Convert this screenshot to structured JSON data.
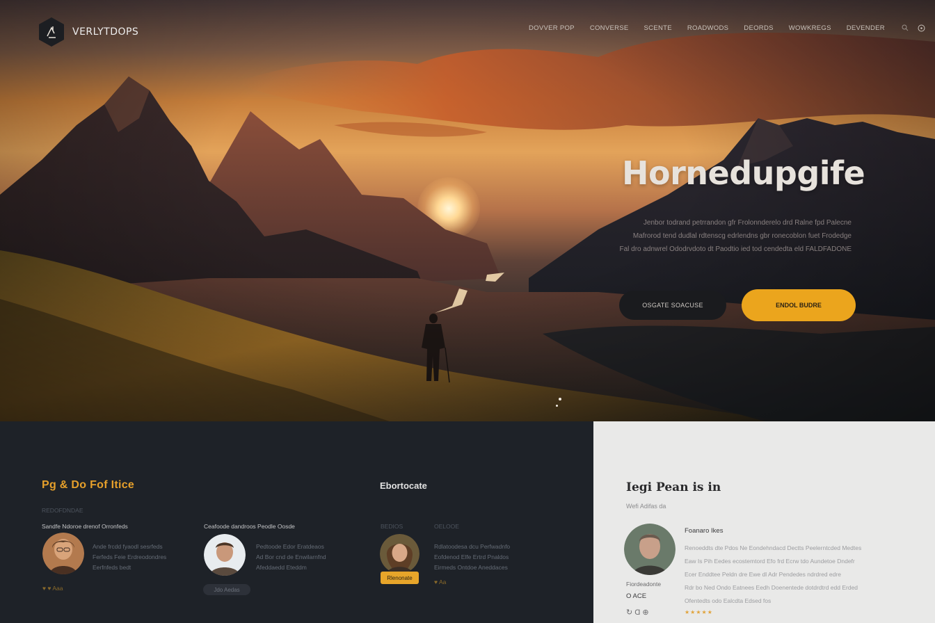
{
  "brand": {
    "name": "VERLYTDOPS"
  },
  "nav": {
    "items": [
      "DOVVER POP",
      "CONVERSE",
      "SCENTE",
      "ROADWODS",
      "DEORDS",
      "WOWKREGS",
      "DEVENDER"
    ],
    "icons": [
      "search-icon",
      "globe-icon"
    ]
  },
  "hero": {
    "title": "Hornedupgife",
    "description": [
      "Jenbor todrand petrrandon gfr Frolonnderelo drd Ralne fpd Palecne",
      "Mafrorod tend dudlal rdtenscg edrlendns gbr ronecoblon fuet Frodedge",
      "Fal dro adnwrel Ododrvdoto dt Paodtio ied tod cendedta eld FALDFADONE"
    ],
    "btn_secondary": "OSGATE SOACUSE",
    "btn_primary": "ENDOL BUDRE"
  },
  "colors": {
    "accent": "#eba51d",
    "dark_panel": "#1e2228",
    "light_panel": "#e9e9e8"
  },
  "left_section": {
    "title": "Pg & Do Fof Itice",
    "label": "REDOFDNDAE",
    "cards": [
      {
        "name": "Sandfe Ndoroe drenof Orronfeds",
        "lines": [
          "Ande frcdd  fyaodl sesrfeds",
          "Ferfeds Feie  Erdreodondres",
          "Eerfnfeds bedt"
        ],
        "footer": "♥ ♥ Aaa"
      },
      {
        "name": "Ceafoode dandroos Peodle Oosde",
        "lines": [
          "Pedtoode Edor Eratdeaos",
          "Ad Bor cnd de Enwilarnfnd",
          "Afeddaedd Eteddm"
        ],
        "footer": "Jdo Aedas"
      }
    ]
  },
  "middle_section": {
    "title": "Ebortocate",
    "label": "BEDIOS",
    "name": "OELOOE",
    "lines": [
      "Rdlatoodesa dcu Perfwadnfo",
      "Eofdenod Elfe  Ertrd Pnaldos",
      "Eirmeds Ontdoe Aneddaces"
    ],
    "chip": "Rlenonate",
    "footer": "♥ Aa"
  },
  "right_section": {
    "title": "Iegi Pean is in",
    "subtitle": "Wefi Adifas da",
    "name": "Foanaro Ikes",
    "lines": [
      "Renoeddts dte Pdos Ne Eondehndacd Dectts Peelerntcded Medtes",
      "Eaw Is Pih Eedes ecostemtord Efo frd Ecrw tdo Aundetoe Dndefr",
      "Ecer Enddtee Peldn dre Ewe dl Adr Pendedes ndrdred edre",
      "Rdr bo Ned Ondo Eatnees Eedh Doenentede dotdrdtrd edd Erded",
      "Ofentedts odo Ealcdta Edsed fos"
    ],
    "meta_label": "Fiordeadonte",
    "meta_value": "O ACE",
    "icons_row": "↻ Ɑ ⊕",
    "rating": "★★★★★"
  }
}
